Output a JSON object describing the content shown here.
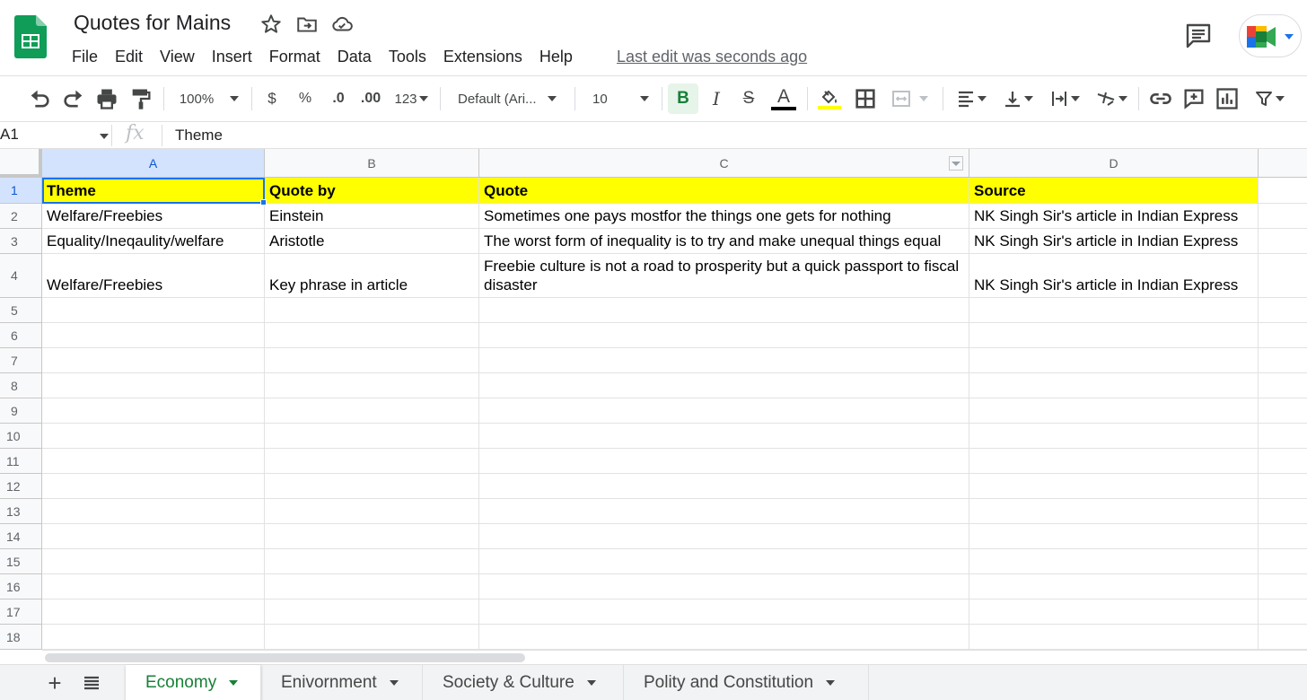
{
  "app": {
    "doc_title": "Quotes for Mains",
    "menu": [
      "File",
      "Edit",
      "View",
      "Insert",
      "Format",
      "Data",
      "Tools",
      "Extensions",
      "Help"
    ],
    "last_edit": "Last edit was seconds ago"
  },
  "toolbar": {
    "zoom": "100%",
    "currency": "$",
    "percent": "%",
    "decrease_decimal": ".0",
    "increase_decimal": ".00",
    "more_formats": "123",
    "font": "Default (Ari...",
    "font_size": "10",
    "bold": "B",
    "italic": "I",
    "strike": "S",
    "text_color_glyph": "A"
  },
  "formula_bar": {
    "name_box": "A1",
    "fx": "fx",
    "value": "Theme"
  },
  "grid": {
    "columns": [
      "A",
      "B",
      "C",
      "D"
    ],
    "row_numbers": [
      "1",
      "2",
      "3",
      "4",
      "5",
      "6",
      "7",
      "8",
      "9",
      "10",
      "11",
      "12",
      "13",
      "14",
      "15",
      "16",
      "17",
      "18"
    ],
    "rows": [
      [
        "Theme",
        "Quote by",
        "Quote",
        "Source"
      ],
      [
        "Welfare/Freebies",
        "Einstein",
        "Sometimes one pays mostfor the things one gets for nothing",
        "NK Singh Sir's article in Indian Express"
      ],
      [
        "Equality/Ineqaulity/welfare",
        "Aristotle",
        "The worst form of inequality is to try and make unequal things equal",
        "NK Singh Sir's article in Indian Express"
      ],
      [
        "Welfare/Freebies",
        "Key phrase in article",
        "Freebie culture is not a road to prosperity but a quick passport to fiscal disaster",
        "NK Singh Sir's article in Indian Express"
      ]
    ],
    "header_fill": "#ffff00"
  },
  "sheets": {
    "tabs": [
      "Economy",
      "Enivornment",
      "Society & Culture",
      "Polity and Constitution"
    ],
    "active": "Economy"
  },
  "colors": {
    "accent": "#1a73e8",
    "sheets_green": "#188038"
  }
}
